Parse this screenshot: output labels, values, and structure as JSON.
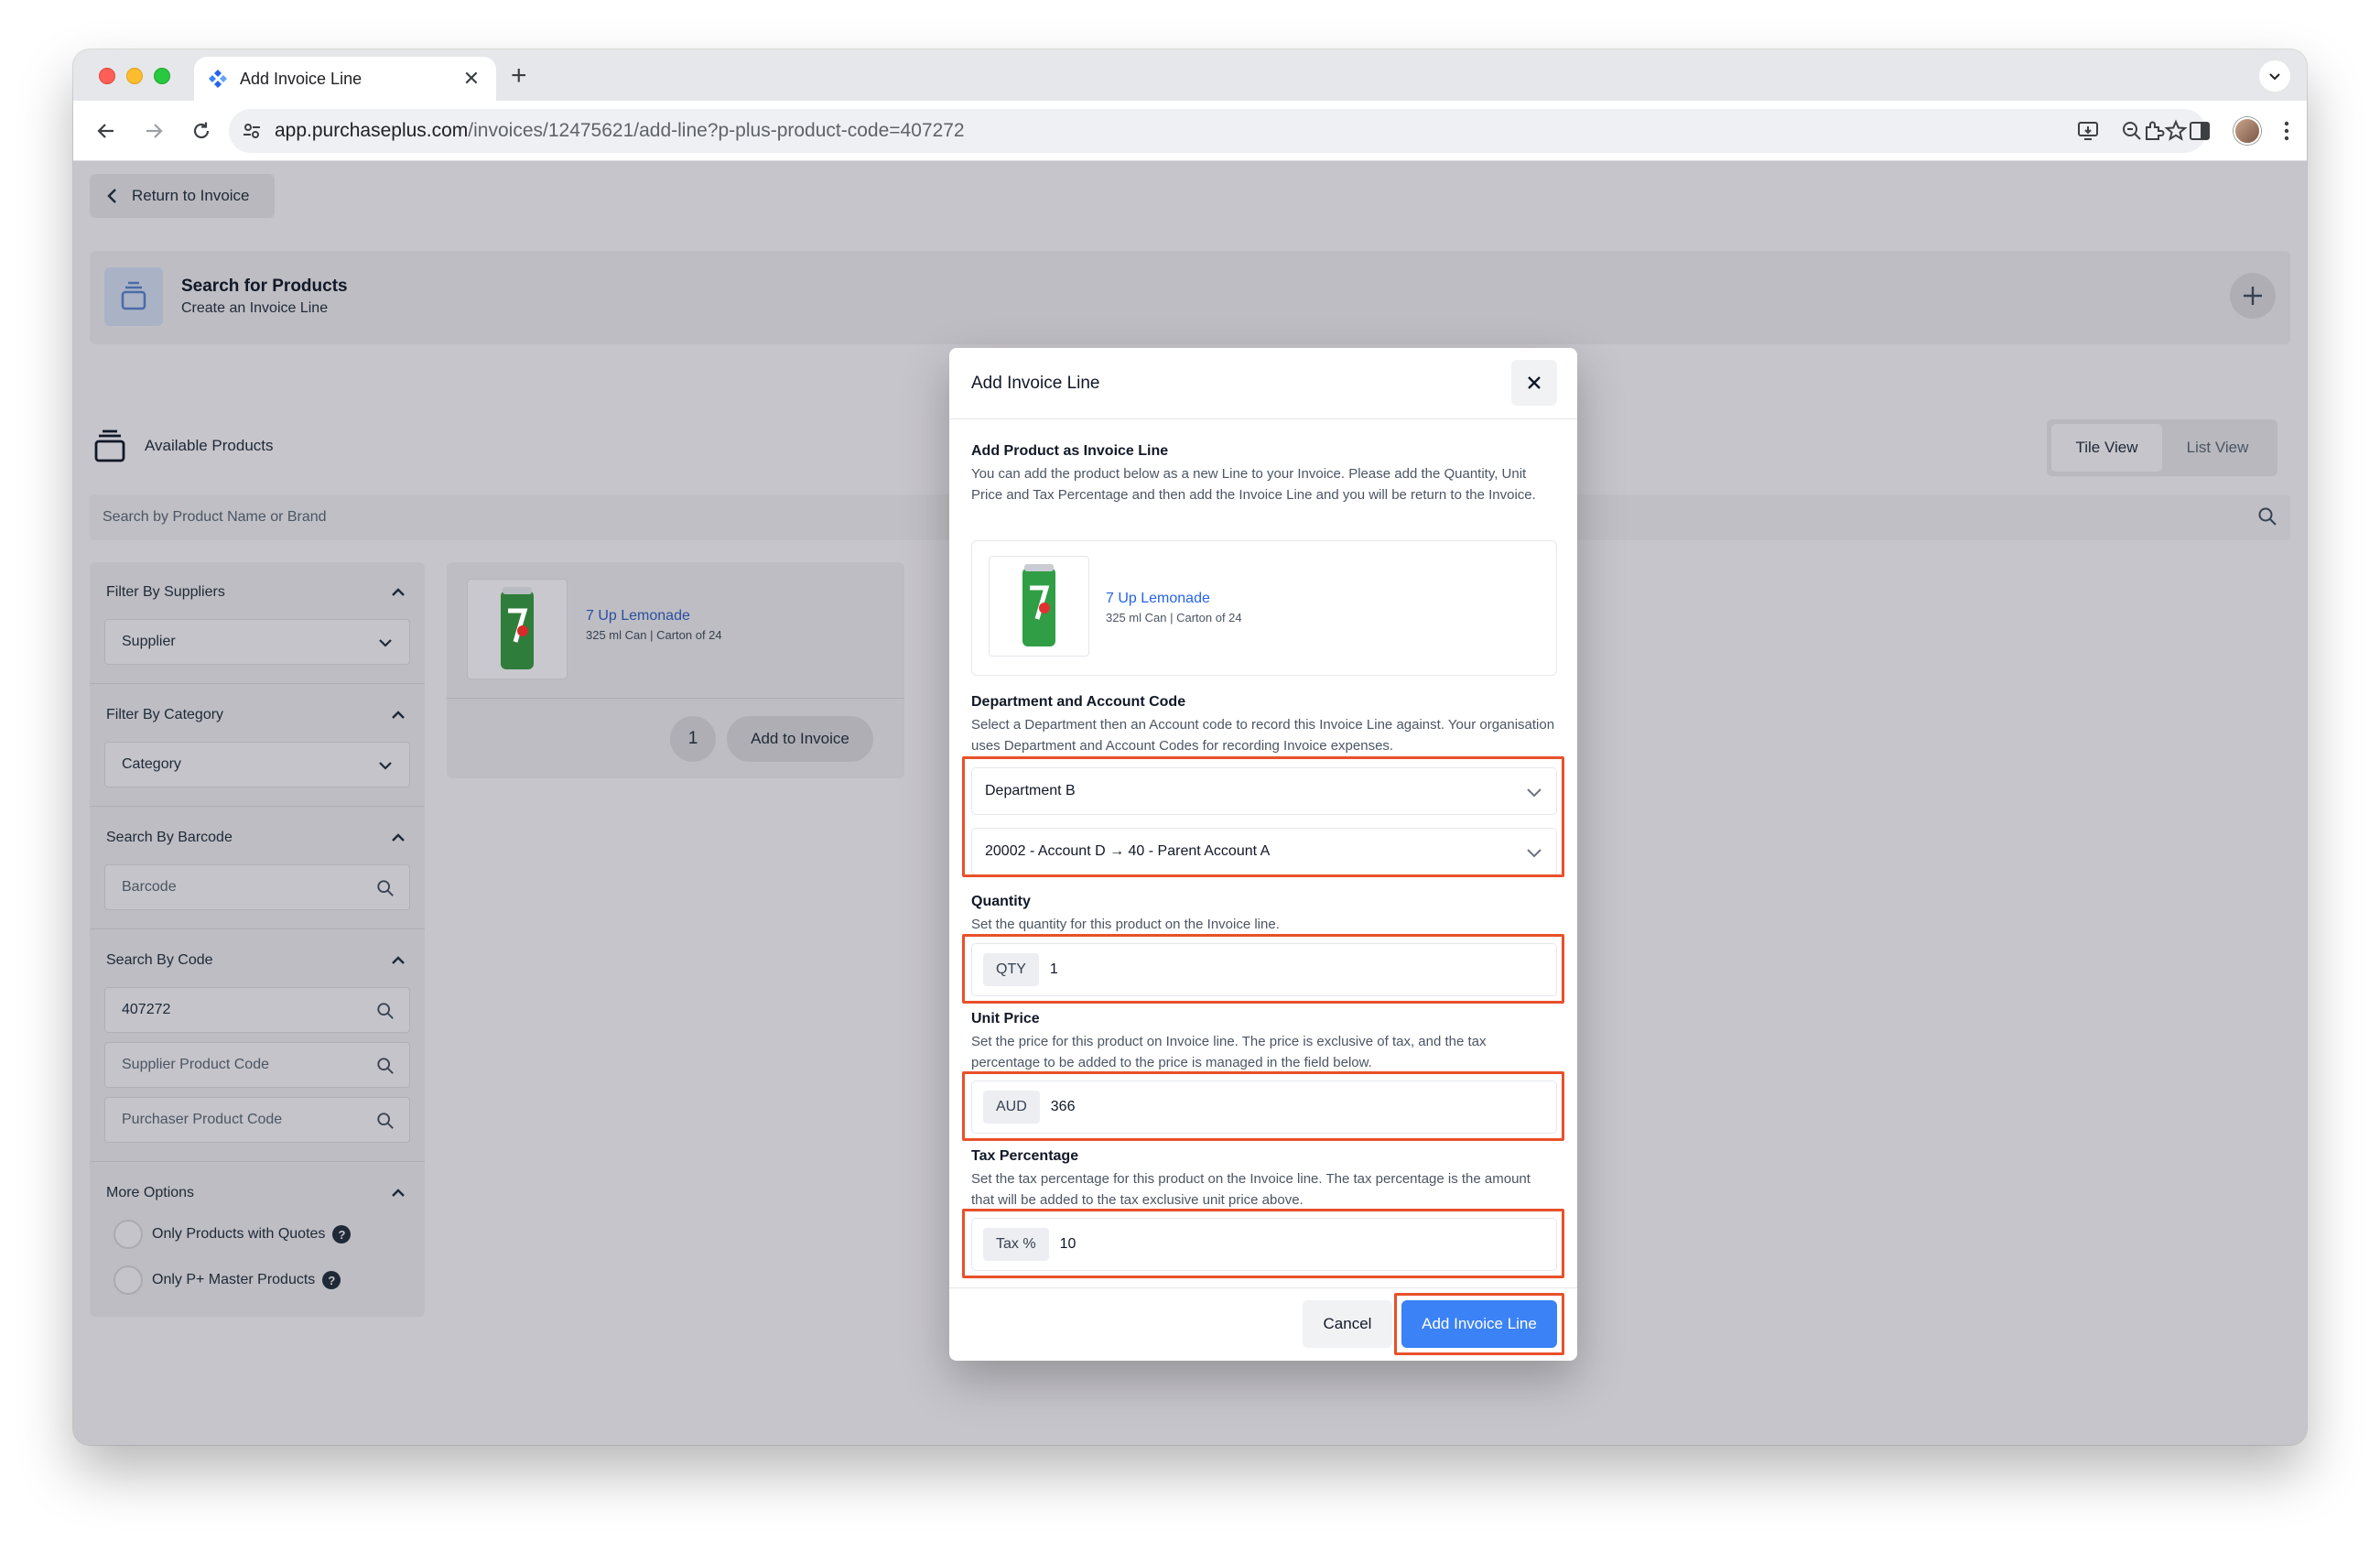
{
  "browser": {
    "tab_title": "Add Invoice Line",
    "url_host": "app.purchaseplus.com",
    "url_path": "/invoices/12475621/add-line?p-plus-product-code=407272"
  },
  "page": {
    "return_label": "Return to Invoice",
    "header": {
      "title": "Search for Products",
      "subtitle": "Create an Invoice Line"
    },
    "available_label": "Available Products",
    "view_toggle": [
      "Tile View",
      "List View"
    ],
    "search_placeholder": "Search by Product Name or Brand"
  },
  "sidebar": {
    "suppliers_title": "Filter By Suppliers",
    "supplier_value": "Supplier",
    "category_title": "Filter By Category",
    "category_value": "Category",
    "barcode_title": "Search By Barcode",
    "barcode_placeholder": "Barcode",
    "code_title": "Search By Code",
    "code_value": "407272",
    "supplier_code_placeholder": "Supplier Product Code",
    "purchaser_code_placeholder": "Purchaser Product Code",
    "more_options_title": "More Options",
    "option_quotes": "Only Products with Quotes",
    "option_master": "Only P+ Master Products",
    "help_glyph": "?"
  },
  "product": {
    "name": "7 Up Lemonade",
    "desc": "325 ml Can | Carton of 24",
    "qty": "1",
    "add_label": "Add to Invoice"
  },
  "modal": {
    "title": "Add Invoice Line",
    "add_product_label": "Add Product as Invoice Line",
    "add_product_help": "You can add the product below as a new Line to your Invoice. Please add the Quantity, Unit Price and Tax Percentage and then add the Invoice Line and you will be return to the Invoice.",
    "dept_label": "Department and Account Code",
    "dept_help": "Select a Department then an Account code to record this Invoice Line against. Your organisation uses Department and Account Codes for recording Invoice expenses.",
    "department_value": "Department B",
    "account_value": "20002 - Account D → 40 - Parent Account A",
    "qty_label": "Quantity",
    "qty_help": "Set the quantity for this product on the Invoice line.",
    "qty_addon": "QTY",
    "qty_value": "1",
    "price_label": "Unit Price",
    "price_help": "Set the price for this product on Invoice line. The price is exclusive of tax, and the tax percentage to be added to the price is managed in the field below.",
    "price_addon": "AUD",
    "price_value": "366",
    "tax_label": "Tax Percentage",
    "tax_help": "Set the tax percentage for this product on the Invoice line. The tax percentage is the amount that will be added to the tax exclusive unit price above.",
    "tax_addon": "Tax %",
    "tax_value": "10",
    "cancel_label": "Cancel",
    "submit_label": "Add Invoice Line"
  },
  "colors": {
    "accent": "#3b82f6",
    "highlight": "#e8502a",
    "link": "#2563eb"
  }
}
